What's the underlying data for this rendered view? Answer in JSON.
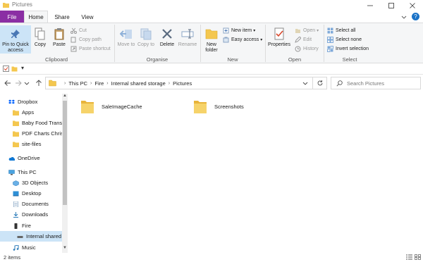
{
  "window": {
    "title": "Pictures"
  },
  "tabs": [
    {
      "label": "File"
    },
    {
      "label": "Home"
    },
    {
      "label": "Share"
    },
    {
      "label": "View"
    }
  ],
  "ribbon": {
    "clipboard": {
      "label": "Clipboard",
      "pin": "Pin to Quick access",
      "copy": "Copy",
      "paste": "Paste",
      "cut": "Cut",
      "copy_path": "Copy path",
      "paste_shortcut": "Paste shortcut"
    },
    "organise": {
      "label": "Organise",
      "move_to": "Move to",
      "copy_to": "Copy to",
      "delete": "Delete",
      "rename": "Rename"
    },
    "new": {
      "label": "New",
      "new_folder": "New folder",
      "new_item": "New item",
      "easy_access": "Easy access"
    },
    "open": {
      "label": "Open",
      "properties": "Properties",
      "open": "Open",
      "edit": "Edit",
      "history": "History"
    },
    "select": {
      "label": "Select",
      "select_all": "Select all",
      "select_none": "Select none",
      "invert_selection": "Invert selection"
    }
  },
  "address": {
    "crumbs": [
      "This PC",
      "Fire",
      "Internal shared storage",
      "Pictures"
    ]
  },
  "search": {
    "placeholder": "Search Pictures"
  },
  "nav": [
    {
      "label": "Dropbox",
      "icon": "dropbox-icon"
    },
    {
      "label": "Apps",
      "icon": "folder-icon"
    },
    {
      "label": "Baby Food Trans",
      "icon": "folder-icon"
    },
    {
      "label": "PDF Charts Chris",
      "icon": "folder-icon"
    },
    {
      "label": "site-files",
      "icon": "folder-icon"
    },
    {
      "label": "OneDrive",
      "icon": "onedrive-icon"
    },
    {
      "label": "This PC",
      "icon": "pc-icon"
    },
    {
      "label": "3D Objects",
      "icon": "cube-icon"
    },
    {
      "label": "Desktop",
      "icon": "desktop-icon"
    },
    {
      "label": "Documents",
      "icon": "documents-icon"
    },
    {
      "label": "Downloads",
      "icon": "download-icon"
    },
    {
      "label": "Fire",
      "icon": "device-icon"
    },
    {
      "label": "Internal shared",
      "icon": "drive-icon"
    },
    {
      "label": "Music",
      "icon": "music-icon"
    }
  ],
  "items": [
    {
      "name": "SaleImageCache"
    },
    {
      "name": "Screenshots"
    }
  ],
  "status": {
    "count": "2 items"
  },
  "colors": {
    "file_tab": "#8b2ea4",
    "folder": "#f4c74f",
    "selection": "#cce4f7",
    "accent": "#1a73c7"
  }
}
